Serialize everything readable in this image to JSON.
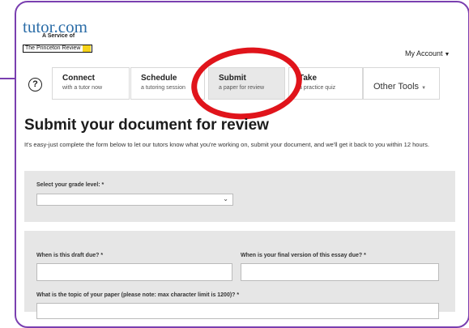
{
  "brand": {
    "logo_text": "tutor.com",
    "logo_tagline": "A Service of",
    "logo_partner": "The Princeton Review"
  },
  "header": {
    "my_account": "My Account"
  },
  "nav": {
    "help_symbol": "?",
    "tabs": [
      {
        "label": "Connect",
        "sub": "with a tutor now"
      },
      {
        "label": "Schedule",
        "sub": "a tutoring session"
      },
      {
        "label": "Submit",
        "sub": "a paper for review"
      },
      {
        "label": "Take",
        "sub": "a practice quiz"
      }
    ],
    "other_tools": "Other Tools"
  },
  "annotation": {
    "color": "#e0141b",
    "target": "Submit tab"
  },
  "main": {
    "title": "Submit your document for review",
    "intro": "It's easy-just complete the form below to let our tutors know what you're working on, submit your document, and we'll get it back to you within 12 hours."
  },
  "form": {
    "grade_label": "Select your grade level: *",
    "grade_value": "",
    "draft_due_label": "When is this draft due? *",
    "draft_due_value": "",
    "final_due_label": "When is your final version of this essay due? *",
    "final_due_value": "",
    "topic_label": "What is the topic of your paper (please note: max character limit is 1200)? *",
    "topic_value": ""
  },
  "colors": {
    "frame_border": "#7a3fb0",
    "logo_blue": "#2d6ea8",
    "active_tab_bg": "#e8e8e8",
    "form_panel_bg": "#e6e6e6"
  }
}
